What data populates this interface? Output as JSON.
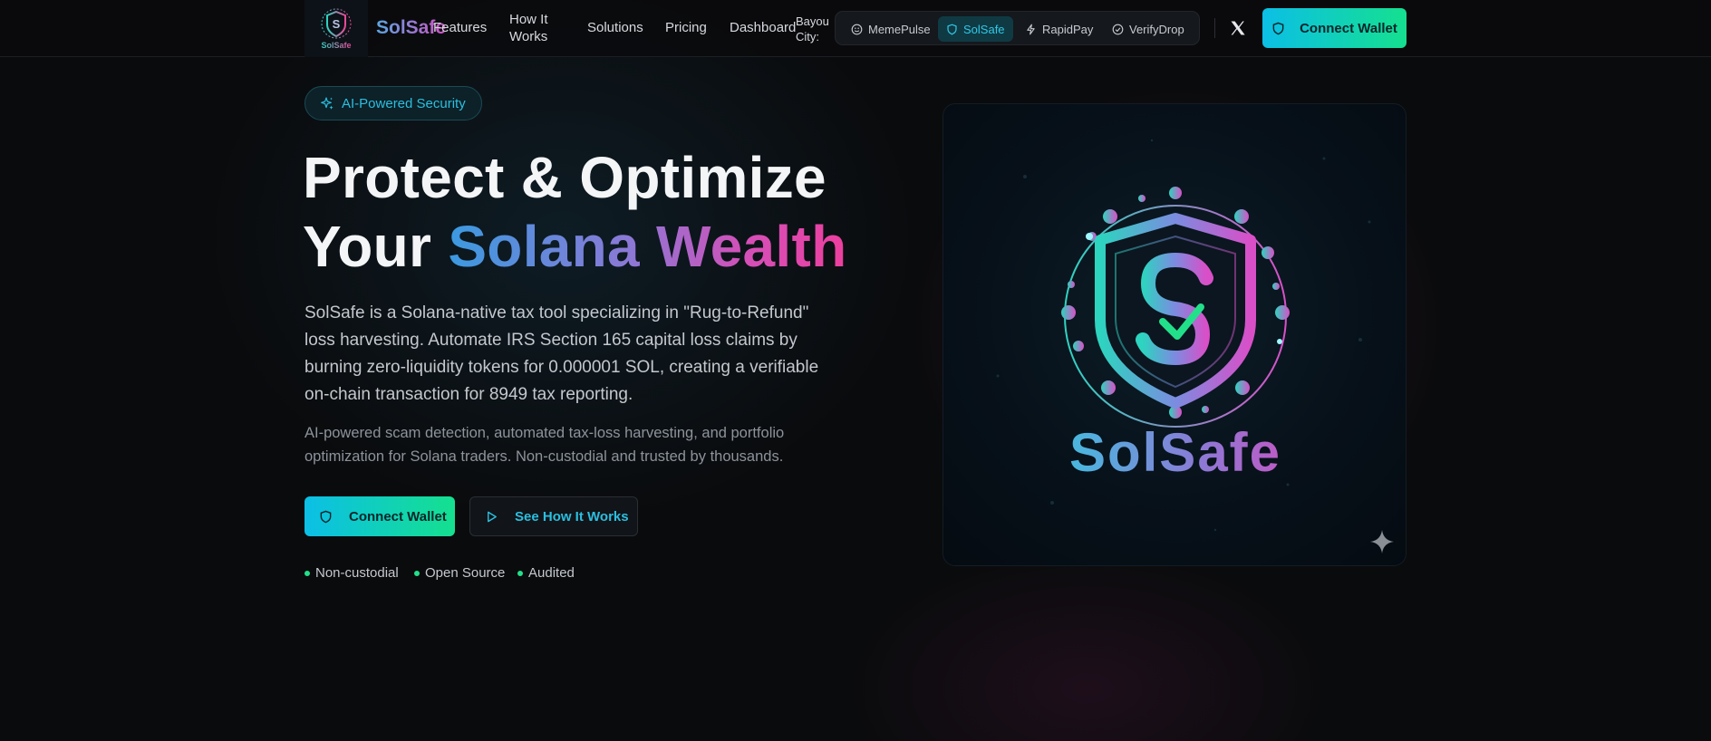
{
  "nav": {
    "brand": "SolSafe",
    "logo_word": "SolSafe",
    "links": [
      "Features",
      "How It Works",
      "Solutions",
      "Pricing",
      "Dashboard"
    ],
    "city_label": "Bayou City:",
    "city_items": [
      {
        "label": "MemePulse",
        "icon": "smile-icon",
        "active": false
      },
      {
        "label": "SolSafe",
        "icon": "shield-icon",
        "active": true
      },
      {
        "label": "RapidPay",
        "icon": "bolt-icon",
        "active": false
      },
      {
        "label": "VerifyDrop",
        "icon": "check-circle-icon",
        "active": false
      }
    ],
    "connect_label": "Connect Wallet"
  },
  "hero": {
    "badge": "AI-Powered Security",
    "headline_line1": "Protect & Optimize",
    "headline_line2_plain": "Your ",
    "headline_line2_grad": "Solana Wealth",
    "description": "SolSafe is a Solana-native tax tool specializing in \"Rug-to-Refund\" loss harvesting. Automate IRS Section 165 capital loss claims by burning zero-liquidity tokens for 0.000001 SOL, creating a verifiable on-chain transaction for 8949 tax reporting.",
    "subtext": "AI-powered scam detection, automated tax-loss harvesting, and portfolio optimization for Solana traders. Non-custodial and trusted by thousands.",
    "primary_cta": "Connect Wallet",
    "secondary_cta": "See How It Works",
    "trust_items": [
      "Non-custodial",
      "Open Source",
      "Audited"
    ]
  },
  "hero_image": {
    "wordmark": "SolSafe"
  },
  "colors": {
    "accent_cyan": "#0bbfe6",
    "accent_green": "#15e08f",
    "accent_pink": "#ec3f9e",
    "background": "#0a0b0d"
  }
}
